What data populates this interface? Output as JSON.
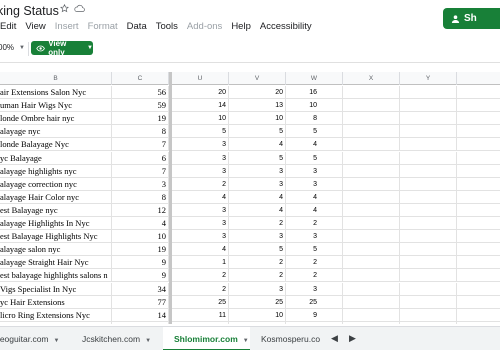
{
  "doc": {
    "title": "king Status"
  },
  "share": {
    "label": "Sh"
  },
  "menu": [
    "Edit",
    "View",
    "Insert",
    "Format",
    "Data",
    "Tools",
    "Add-ons",
    "Help",
    "Accessibility"
  ],
  "menu_disabled": [
    "Insert",
    "Format",
    "Add-ons"
  ],
  "toolbar": {
    "zoom": "00%",
    "view_only": "View only"
  },
  "columns": [
    "B",
    "C",
    "U",
    "V",
    "W",
    "X",
    "Y"
  ],
  "rows": [
    {
      "kw": "air Extensions Salon Nyc",
      "c": "56",
      "u": "20",
      "v": "20",
      "w": "16"
    },
    {
      "kw": "uman Hair Wigs Nyc",
      "c": "59",
      "u": "14",
      "v": "13",
      "w": "10"
    },
    {
      "kw": "londe Ombre hair nyc",
      "c": "19",
      "u": "10",
      "v": "10",
      "w": "8"
    },
    {
      "kw": "alayage nyc",
      "c": "8",
      "u": "5",
      "v": "5",
      "w": "5"
    },
    {
      "kw": "londe Balayage Nyc",
      "c": "7",
      "u": "3",
      "v": "4",
      "w": "4"
    },
    {
      "kw": "yc Balayage",
      "c": "6",
      "u": "3",
      "v": "5",
      "w": "5"
    },
    {
      "kw": "alayage highlights nyc",
      "c": "7",
      "u": "3",
      "v": "3",
      "w": "3"
    },
    {
      "kw": "alayage correction nyc",
      "c": "3",
      "u": "2",
      "v": "3",
      "w": "3"
    },
    {
      "kw": "alayage Hair Color nyc",
      "c": "8",
      "u": "4",
      "v": "4",
      "w": "4"
    },
    {
      "kw": "est Balayage nyc",
      "c": "12",
      "u": "3",
      "v": "4",
      "w": "4"
    },
    {
      "kw": "alayage Highlights In Nyc",
      "c": "4",
      "u": "3",
      "v": "2",
      "w": "2"
    },
    {
      "kw": "est Balayage Highlights Nyc",
      "c": "10",
      "u": "3",
      "v": "3",
      "w": "3"
    },
    {
      "kw": "alayage salon nyc",
      "c": "19",
      "u": "4",
      "v": "5",
      "w": "5"
    },
    {
      "kw": "alayage Straight Hair Nyc",
      "c": "9",
      "u": "1",
      "v": "2",
      "w": "2"
    },
    {
      "kw": "est balayage highlights salons n",
      "c": "9",
      "u": "2",
      "v": "2",
      "w": "2"
    },
    {
      "kw": "Vigs Specialist In Nyc",
      "c": "34",
      "u": "2",
      "v": "3",
      "w": "3"
    },
    {
      "kw": "yc Hair Extensions",
      "c": "77",
      "u": "25",
      "v": "25",
      "w": "25"
    },
    {
      "kw": "licro Ring Extensions Nyc",
      "c": "14",
      "u": "11",
      "v": "10",
      "w": "9"
    },
    {
      "kw": "",
      "c": "",
      "u": "",
      "v": "",
      "w": ""
    }
  ],
  "tabs": [
    {
      "label": "reoguitar.com",
      "active": false
    },
    {
      "label": "Jcskitchen.com",
      "active": false
    },
    {
      "label": "Shlomimor.com",
      "active": true
    },
    {
      "label": "Kosmosperu.co",
      "active": false
    }
  ],
  "colors": {
    "accent": "#188038",
    "header_bg": "#f8f9fa",
    "grid_line": "#e2e2e2"
  }
}
